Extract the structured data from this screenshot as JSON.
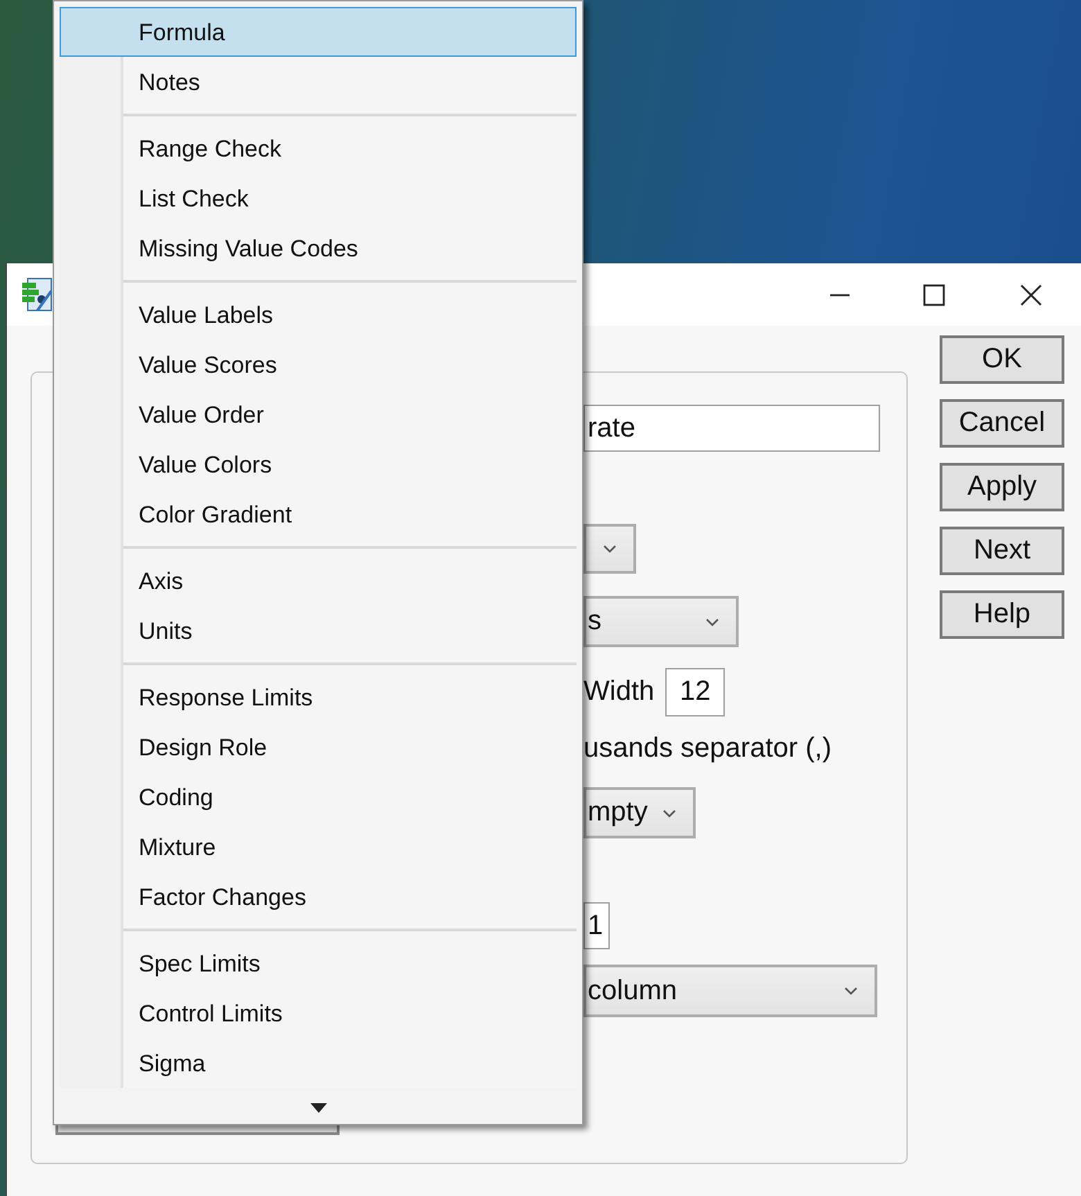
{
  "dialog": {
    "buttons": [
      {
        "label": "OK"
      },
      {
        "label": "Cancel"
      },
      {
        "label": "Apply"
      },
      {
        "label": "Next"
      },
      {
        "label": "Help"
      }
    ],
    "form_rows": [
      {
        "kind": "field",
        "value": "rate"
      },
      {
        "kind": "dropdown"
      },
      {
        "kind": "dropdown",
        "value": "s"
      },
      {
        "kind": "labeled_field",
        "label": "Width",
        "value": "12"
      },
      {
        "kind": "label",
        "label": "usands separator (,)"
      },
      {
        "kind": "dropdown",
        "value": "mpty"
      },
      {
        "kind": "field",
        "value": "1"
      },
      {
        "kind": "dropdown",
        "value": "column"
      }
    ]
  },
  "menu": {
    "groups": [
      {
        "items": [
          {
            "label": "Formula",
            "selected": true
          },
          {
            "label": "Notes",
            "selected": false
          }
        ]
      },
      {
        "items": [
          {
            "label": "Range Check",
            "selected": false
          },
          {
            "label": "List Check",
            "selected": false
          },
          {
            "label": "Missing Value Codes",
            "selected": false
          }
        ]
      },
      {
        "items": [
          {
            "label": "Value Labels",
            "selected": false
          },
          {
            "label": "Value Scores",
            "selected": false
          },
          {
            "label": "Value Order",
            "selected": false
          },
          {
            "label": "Value Colors",
            "selected": false
          },
          {
            "label": "Color Gradient",
            "selected": false
          }
        ]
      },
      {
        "items": [
          {
            "label": "Axis",
            "selected": false
          },
          {
            "label": "Units",
            "selected": false
          }
        ]
      },
      {
        "items": [
          {
            "label": "Response Limits",
            "selected": false
          },
          {
            "label": "Design Role",
            "selected": false
          },
          {
            "label": "Coding",
            "selected": false
          },
          {
            "label": "Mixture",
            "selected": false
          },
          {
            "label": "Factor Changes",
            "selected": false
          }
        ]
      },
      {
        "items": [
          {
            "label": "Spec Limits",
            "selected": false
          },
          {
            "label": "Control Limits",
            "selected": false
          },
          {
            "label": "Sigma",
            "selected": false
          }
        ]
      }
    ]
  }
}
